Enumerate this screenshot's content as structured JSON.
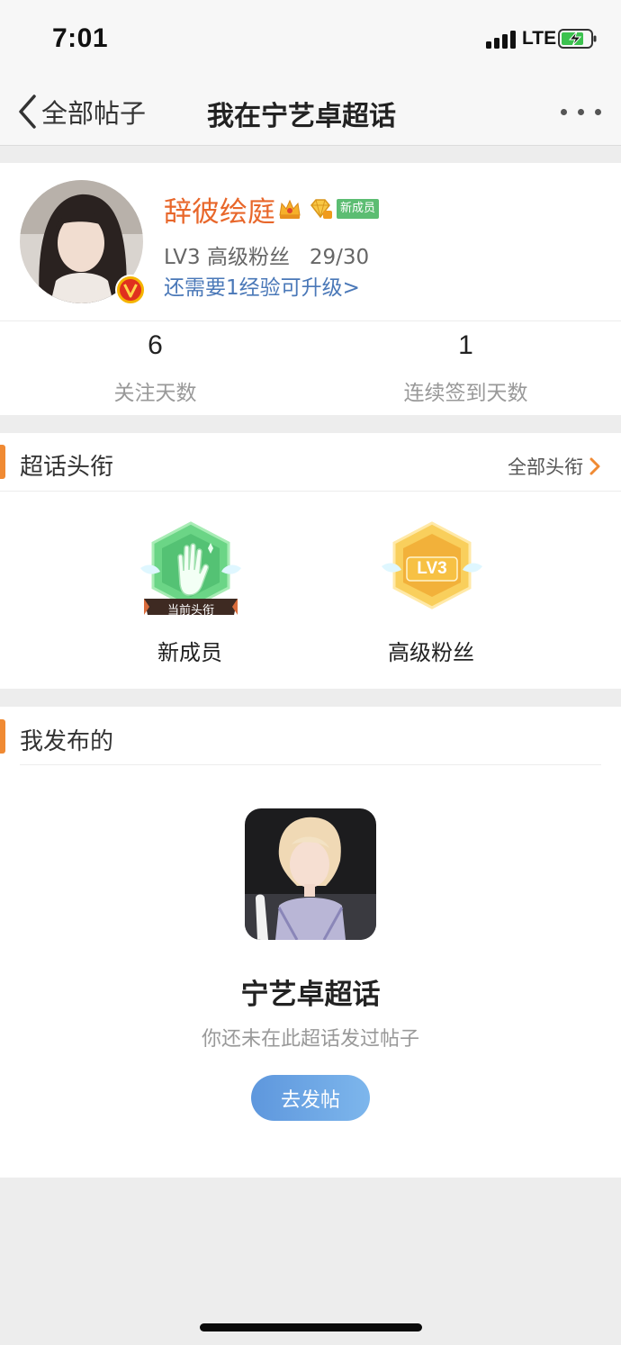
{
  "status_bar": {
    "time": "7:01",
    "network": "LTE"
  },
  "nav": {
    "back_label": "全部帖子",
    "title": "我在宁艺卓超话"
  },
  "profile": {
    "username": "辞彼绘庭",
    "tag": "新成员",
    "level_text": "LV3 高级粉丝   29/30",
    "upgrade_text": "还需要1经验可升级>",
    "stats": [
      {
        "value": "6",
        "label": "关注天数"
      },
      {
        "value": "1",
        "label": "连续签到天数"
      }
    ]
  },
  "titles_section": {
    "title": "超话头衔",
    "all_link": "全部头衔",
    "badges": [
      {
        "name": "新成员",
        "ribbon": "当前头衔",
        "color": "#6bd586"
      },
      {
        "name": "高级粉丝",
        "emblem": "LV3",
        "color": "#f7c144"
      }
    ]
  },
  "posts_section": {
    "title": "我发布的",
    "topic_name": "宁艺卓超话",
    "empty_text": "你还未在此超话发过帖子",
    "post_button": "去发帖"
  },
  "colors": {
    "accent": "#f08a33",
    "username": "#e8672b",
    "link": "#4a78b8",
    "button": "#6aa6e6"
  }
}
